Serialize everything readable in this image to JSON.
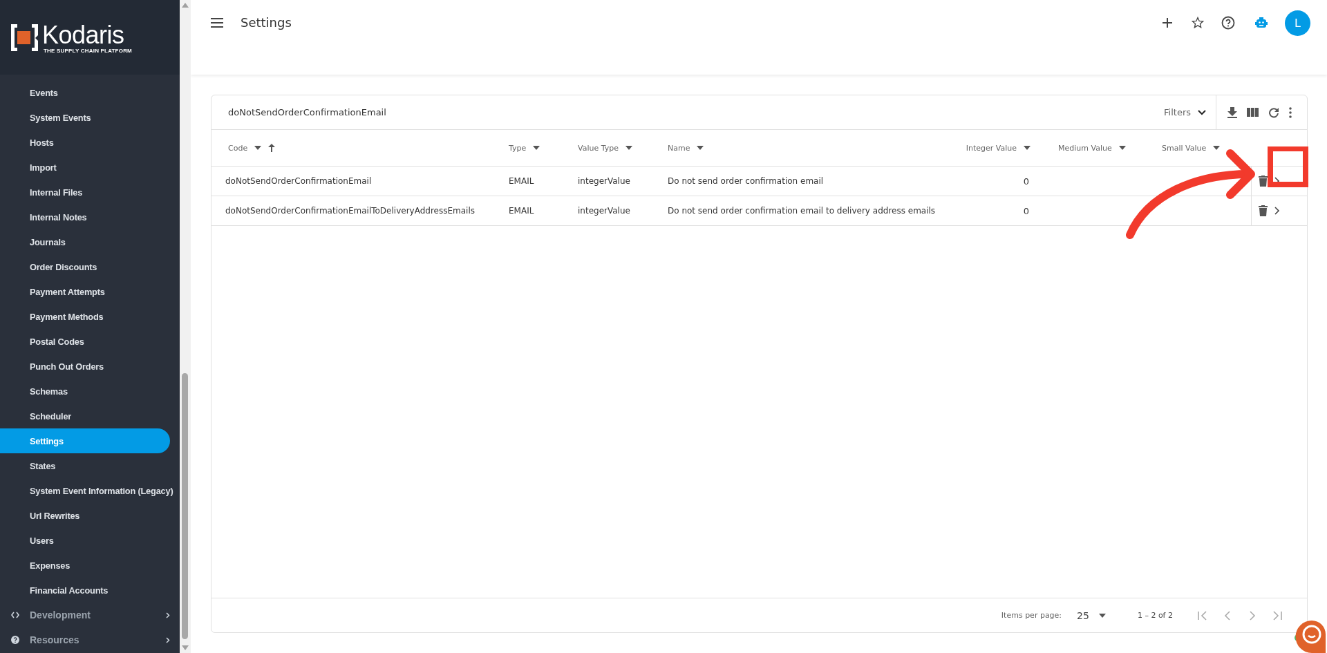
{
  "brand": {
    "name": "Kodaris",
    "tagline": "THE SUPPLY CHAIN PLATFORM"
  },
  "sidebar": {
    "items": [
      {
        "label": "Events",
        "selected": false,
        "kind": "link"
      },
      {
        "label": "System Events",
        "selected": false,
        "kind": "link"
      },
      {
        "label": "Hosts",
        "selected": false,
        "kind": "link"
      },
      {
        "label": "Import",
        "selected": false,
        "kind": "link"
      },
      {
        "label": "Internal Files",
        "selected": false,
        "kind": "link"
      },
      {
        "label": "Internal Notes",
        "selected": false,
        "kind": "link"
      },
      {
        "label": "Journals",
        "selected": false,
        "kind": "link"
      },
      {
        "label": "Order Discounts",
        "selected": false,
        "kind": "link"
      },
      {
        "label": "Payment Attempts",
        "selected": false,
        "kind": "link"
      },
      {
        "label": "Payment Methods",
        "selected": false,
        "kind": "link"
      },
      {
        "label": "Postal Codes",
        "selected": false,
        "kind": "link"
      },
      {
        "label": "Punch Out Orders",
        "selected": false,
        "kind": "link"
      },
      {
        "label": "Schemas",
        "selected": false,
        "kind": "link"
      },
      {
        "label": "Scheduler",
        "selected": false,
        "kind": "link"
      },
      {
        "label": "Settings",
        "selected": true,
        "kind": "link"
      },
      {
        "label": "States",
        "selected": false,
        "kind": "link"
      },
      {
        "label": "System Event Information (Legacy)",
        "selected": false,
        "kind": "link"
      },
      {
        "label": "Url Rewrites",
        "selected": false,
        "kind": "link"
      },
      {
        "label": "Users",
        "selected": false,
        "kind": "link"
      },
      {
        "label": "Expenses",
        "selected": false,
        "kind": "link"
      },
      {
        "label": "Financial Accounts",
        "selected": false,
        "kind": "link"
      },
      {
        "label": "Development",
        "selected": false,
        "kind": "code-group"
      },
      {
        "label": "Resources",
        "selected": false,
        "kind": "help-group"
      }
    ]
  },
  "header": {
    "title": "Settings",
    "avatar": "L"
  },
  "table": {
    "search": "doNotSendOrderConfirmationEmail",
    "filters_label": "Filters",
    "columns": [
      {
        "label": "Code",
        "sort_ascending": true,
        "kind": "text"
      },
      {
        "label": "Type",
        "sort_ascending": false,
        "kind": "text"
      },
      {
        "label": "Value Type",
        "sort_ascending": false,
        "kind": "text"
      },
      {
        "label": "Name",
        "sort_ascending": false,
        "kind": "text"
      },
      {
        "label": "Integer Value",
        "sort_ascending": false,
        "kind": "number"
      },
      {
        "label": "Medium Value",
        "sort_ascending": false,
        "kind": "text"
      },
      {
        "label": "Small Value",
        "sort_ascending": false,
        "kind": "text"
      }
    ],
    "rows": [
      {
        "cells": [
          "doNotSendOrderConfirmationEmail",
          "EMAIL",
          "integerValue",
          "Do not send order confirmation email",
          "0"
        ]
      },
      {
        "cells": [
          "doNotSendOrderConfirmationEmailToDeliveryAddressEmails",
          "EMAIL",
          "integerValue",
          "Do not send order confirmation email to delivery address emails",
          "0"
        ]
      }
    ],
    "pagination": {
      "items_per_page_label": "Items per page:",
      "page_size": "25",
      "range": "1 – 2 of 2"
    }
  }
}
